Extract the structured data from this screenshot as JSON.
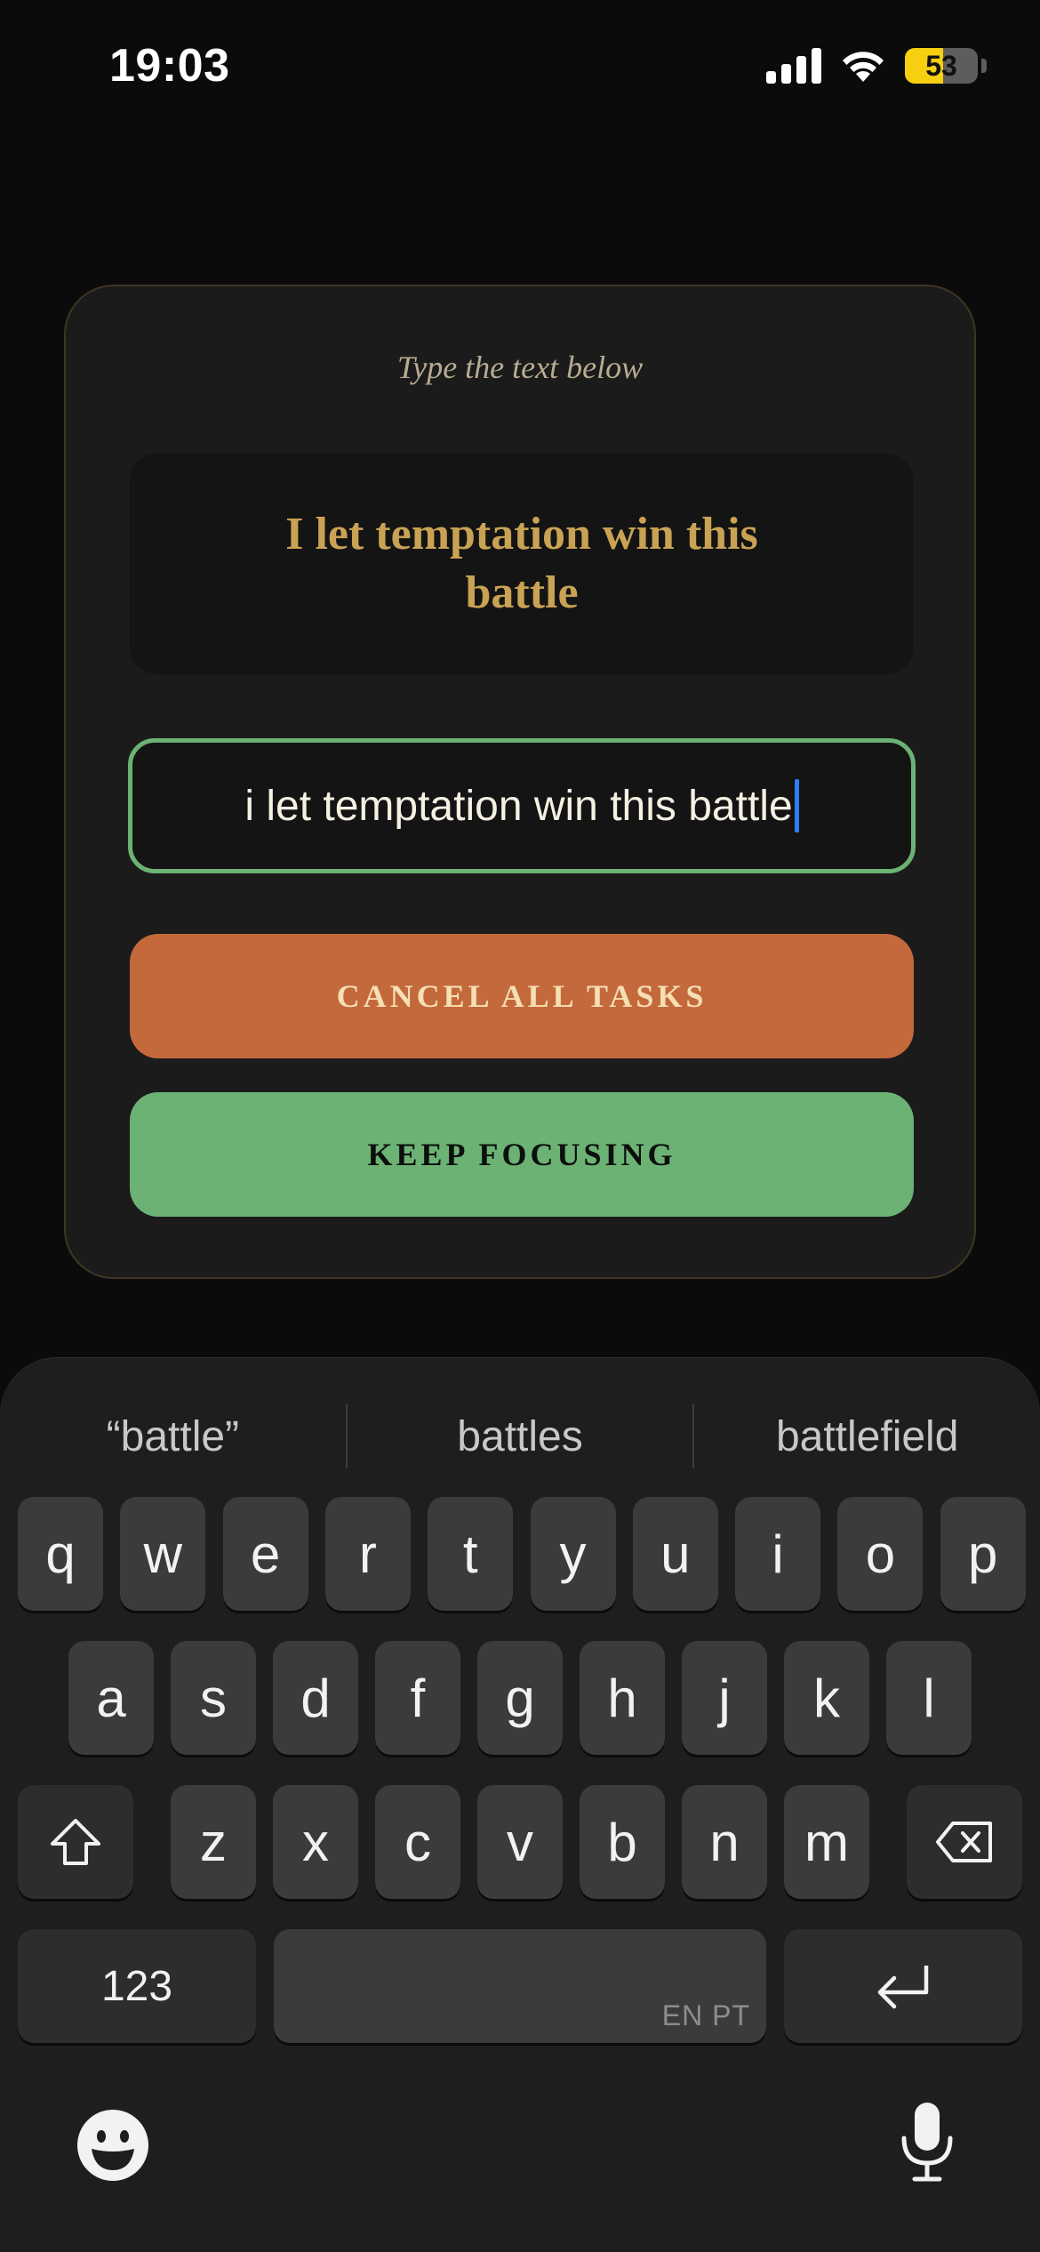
{
  "status_bar": {
    "time": "19:03",
    "battery_percent": 53,
    "battery_label": "53",
    "signal_bars": 4,
    "battery_color": "#f6cf11"
  },
  "dialog": {
    "instruction": "Type the text below",
    "target_text": "I let temptation win this battle",
    "input_value": "i let temptation win this battle",
    "cancel_label": "CANCEL ALL TASKS",
    "keep_label": "KEEP FOCUSING",
    "colors": {
      "gold": "#c9a254",
      "cancel": "#c4693c",
      "keep": "#6cb274",
      "caret": "#2f7ef7"
    }
  },
  "keyboard": {
    "suggestions": [
      "“battle”",
      "battles",
      "battlefield"
    ],
    "row1": [
      "q",
      "w",
      "e",
      "r",
      "t",
      "y",
      "u",
      "i",
      "o",
      "p"
    ],
    "row2": [
      "a",
      "s",
      "d",
      "f",
      "g",
      "h",
      "j",
      "k",
      "l"
    ],
    "row3": [
      "z",
      "x",
      "c",
      "v",
      "b",
      "n",
      "m"
    ],
    "numbers_label": "123",
    "space_languages": "EN PT",
    "icons": {
      "shift": "shift-icon",
      "delete": "backspace-icon",
      "return": "return-icon",
      "emoji": "emoji-icon",
      "dictation": "microphone-icon"
    }
  }
}
